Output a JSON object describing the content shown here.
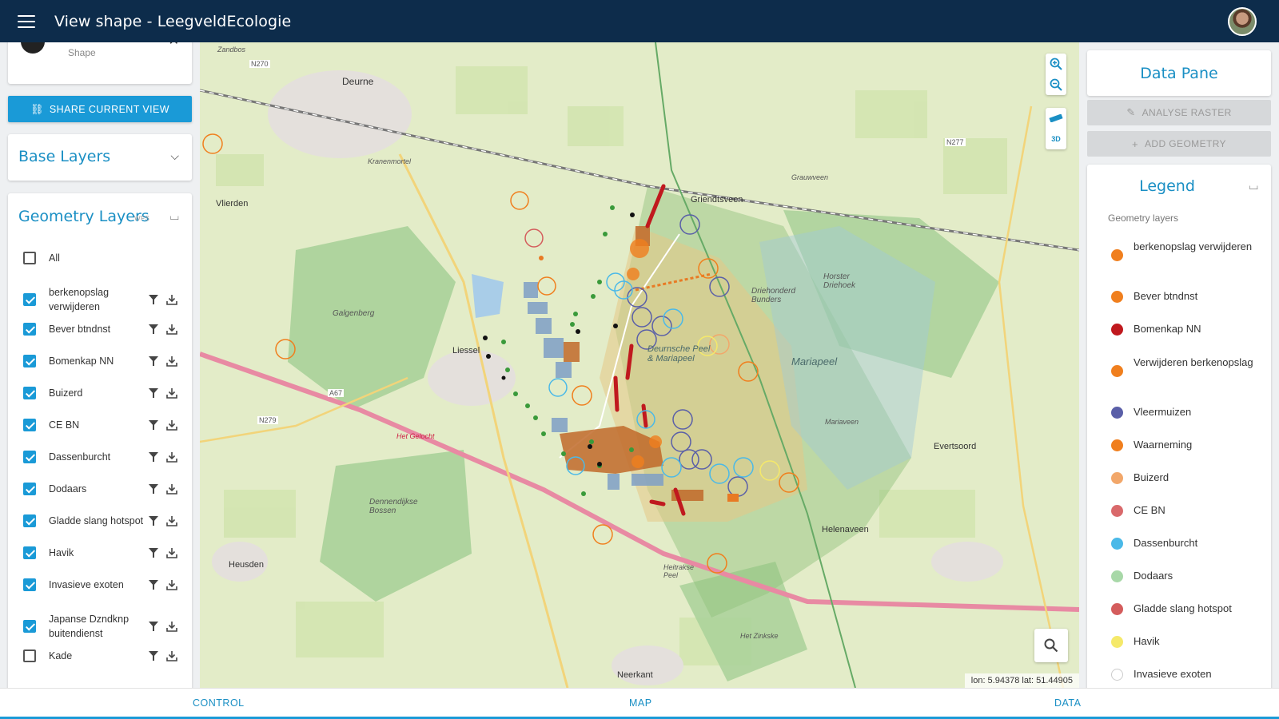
{
  "app": {
    "title": "View shape - LeegveldEcologie"
  },
  "shape_card": {
    "subtitle": "Shape"
  },
  "share_button": {
    "label": "SHARE CURRENT VIEW"
  },
  "base_layers": {
    "title": "Base Layers"
  },
  "geometry_layers": {
    "title": "Geometry Layers",
    "tag": "WFS",
    "items": [
      {
        "label": "All",
        "checked": false,
        "actions": false
      },
      {
        "label": "berkenopslag verwijderen",
        "checked": true,
        "actions": true
      },
      {
        "label": "Bever btndnst",
        "checked": true,
        "actions": true
      },
      {
        "label": "Bomenkap NN",
        "checked": true,
        "actions": true
      },
      {
        "label": "Buizerd",
        "checked": true,
        "actions": true
      },
      {
        "label": "CE BN",
        "checked": true,
        "actions": true
      },
      {
        "label": "Dassenburcht",
        "checked": true,
        "actions": true
      },
      {
        "label": "Dodaars",
        "checked": true,
        "actions": true
      },
      {
        "label": "Gladde slang hotspot",
        "checked": true,
        "actions": true
      },
      {
        "label": "Havik",
        "checked": true,
        "actions": true
      },
      {
        "label": "Invasieve exoten",
        "checked": true,
        "actions": true
      },
      {
        "label": "Japanse Dzndknp buitendienst",
        "checked": true,
        "actions": true
      },
      {
        "label": "Kade",
        "checked": false,
        "actions": true
      }
    ]
  },
  "map": {
    "coords": "lon: 5.94378 lat: 51.44905",
    "labels": [
      "Deurne",
      "Vlierden",
      "Liessel",
      "Griendtsveen",
      "Helenaveen",
      "Neerkant",
      "Evertsoord",
      "Heusden",
      "Mariapeel",
      "Deurnsche Peel & Mariapeel",
      "Galgenberg",
      "Horster Driehoek",
      "Driehonderd Bunders",
      "Dennendijkse Bossen",
      "Heitrakse Peel",
      "Het Zinkske",
      "Zandbos",
      "Kranenmortel",
      "Grauwveen",
      "A67",
      "N270",
      "N279",
      "N277",
      "Het Gelocht",
      "Mariaveen"
    ],
    "controls": {
      "zoom_in": "zoom-in",
      "zoom_out": "zoom-out",
      "measure": "ruler",
      "view3d": "3D"
    }
  },
  "data_pane": {
    "title": "Data Pane",
    "analyse_raster": "ANALYSE RASTER",
    "add_geometry": "ADD GEOMETRY"
  },
  "legend": {
    "title": "Legend",
    "subtitle": "Geometry layers",
    "items": [
      {
        "label": "berkenopslag verwijderen",
        "color": "#f07f1e"
      },
      {
        "label": "Bever btndnst",
        "color": "#f07f1e"
      },
      {
        "label": "Bomenkap NN",
        "color": "#c0191e"
      },
      {
        "label": "Verwijderen berkenopslag",
        "color": "#f07f1e"
      },
      {
        "label": "Vleermuizen",
        "color": "#5a5fa8"
      },
      {
        "label": "Waarneming",
        "color": "#f07f1e"
      },
      {
        "label": "Buizerd",
        "color": "#f2a76a"
      },
      {
        "label": "CE BN",
        "color": "#d9696b"
      },
      {
        "label": "Dassenburcht",
        "color": "#4ab9e8"
      },
      {
        "label": "Dodaars",
        "color": "#a8d8a8"
      },
      {
        "label": "Gladde slang hotspot",
        "color": "#d45c5c"
      },
      {
        "label": "Havik",
        "color": "#f5e96a"
      },
      {
        "label": "Invasieve exoten",
        "color": "#ffffff"
      }
    ]
  },
  "bottom_tabs": {
    "control": "CONTROL",
    "map": "MAP",
    "data": "DATA"
  }
}
